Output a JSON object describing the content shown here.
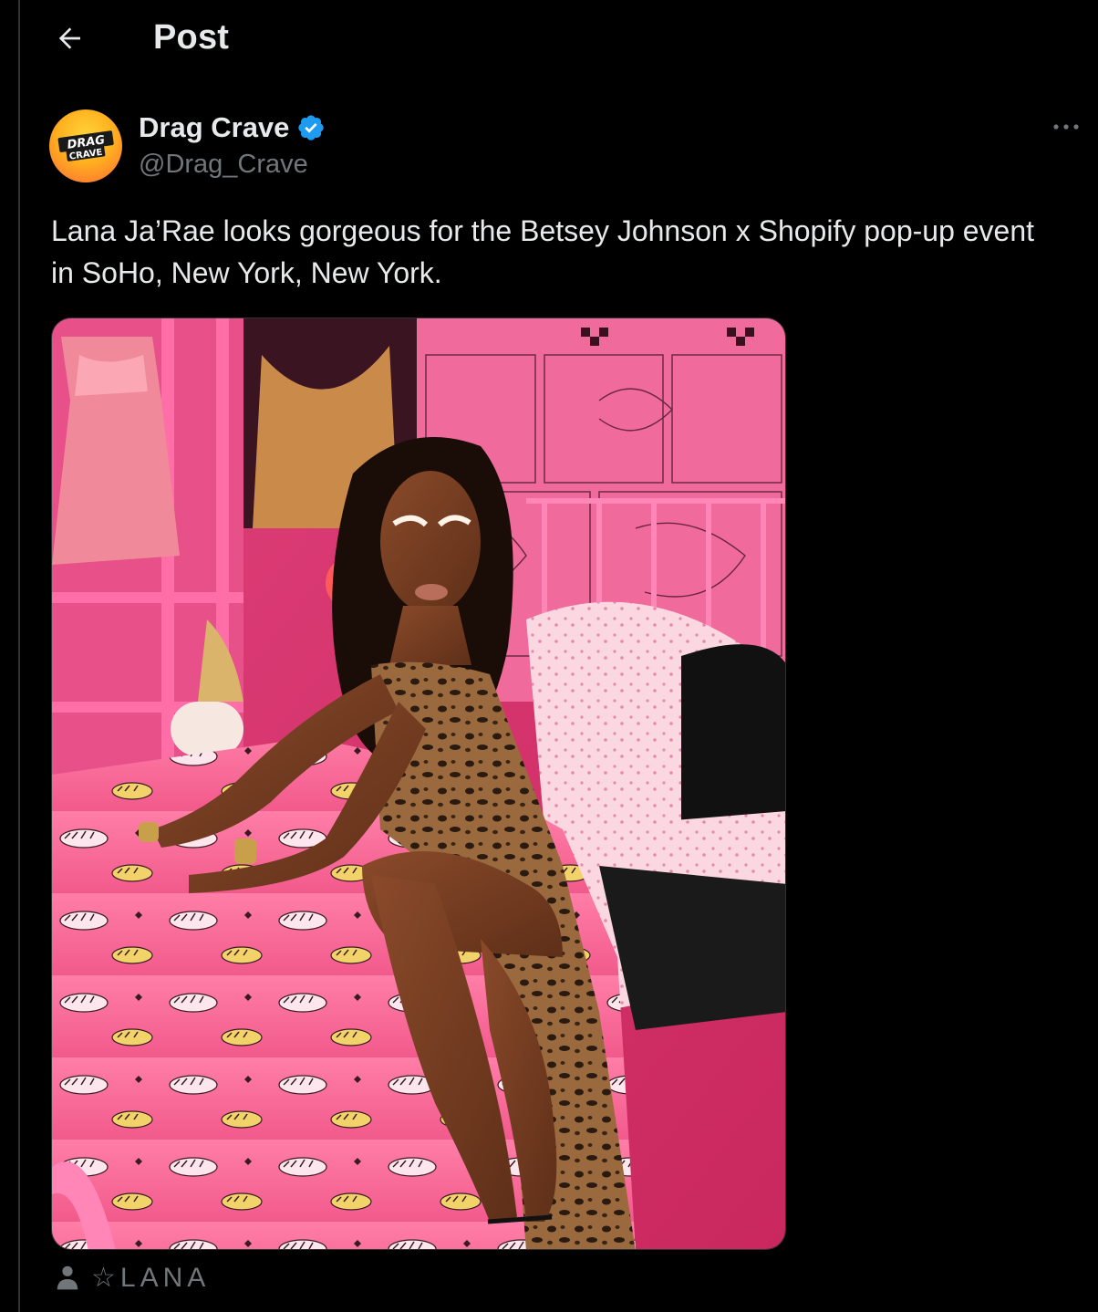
{
  "header": {
    "title": "Post"
  },
  "author": {
    "display_name": "Drag Crave",
    "handle": "@Drag_Crave",
    "verified": true,
    "avatar_logo": {
      "line1": "DRAG",
      "line2": "CRAVE"
    }
  },
  "post": {
    "text": "Lana Ja’Rae looks gorgeous for the Betsey Johnson x Shopify pop-up event in SoHo, New York, New York.",
    "media_icon": "photo"
  },
  "tagged": {
    "label": "☆LANA",
    "icon": "person-icon"
  },
  "colors": {
    "background": "#000000",
    "text_primary": "#e7e9ea",
    "text_secondary": "#71767b",
    "verified_blue": "#1d9bf0",
    "avatar_yellow": "#ffc21f"
  }
}
